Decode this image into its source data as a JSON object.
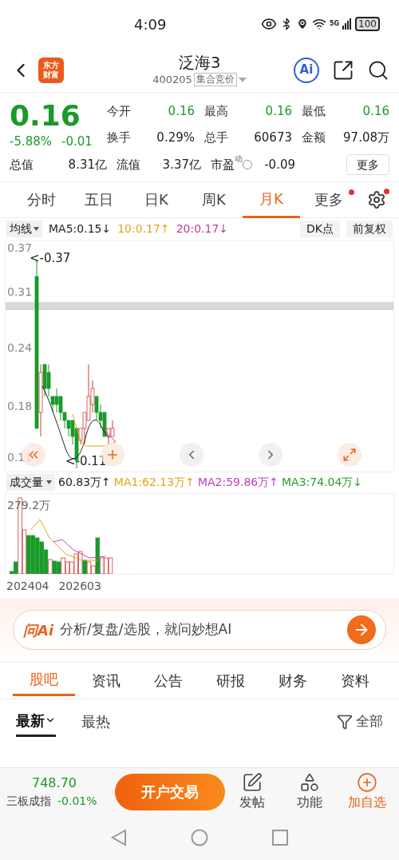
{
  "status_bar": {
    "time": "4:09",
    "network": "5G",
    "battery": "100"
  },
  "header": {
    "logo": [
      "东方",
      "财富"
    ],
    "title": "泛海3",
    "code": "400205",
    "badge": "集合竞价",
    "ai": "Ai"
  },
  "quote": {
    "price": "0.16",
    "change_pct": "-5.88%",
    "change": "-0.01",
    "fields": [
      {
        "label": "今开",
        "value": "0.16",
        "kind": "down"
      },
      {
        "label": "最高",
        "value": "0.16",
        "kind": "down"
      },
      {
        "label": "最低",
        "value": "0.16",
        "kind": "down"
      },
      {
        "label": "换手",
        "value": "0.29%",
        "kind": "flat"
      },
      {
        "label": "总手",
        "value": "60673",
        "kind": "flat"
      },
      {
        "label": "金额",
        "value": "97.08万",
        "kind": "flat"
      },
      {
        "label": "总值",
        "value": "8.31亿",
        "kind": "flat"
      },
      {
        "label": "流值",
        "value": "3.37亿",
        "kind": "flat"
      },
      {
        "label": "市盈",
        "sup": "动",
        "value": "-0.09",
        "kind": "flat"
      }
    ],
    "more": "更多"
  },
  "chart_tabs": [
    {
      "label": "分时",
      "selected": false
    },
    {
      "label": "五日",
      "selected": false
    },
    {
      "label": "日K",
      "selected": false
    },
    {
      "label": "周K",
      "selected": false
    },
    {
      "label": "月K",
      "selected": true
    },
    {
      "label": "更多",
      "selected": false,
      "dot": true
    }
  ],
  "ma_bar": {
    "selector": "均线",
    "items": [
      {
        "text": "MA5:0.15↓",
        "color": "#222222"
      },
      {
        "text": "10:0.17↑",
        "color": "#e8a31c"
      },
      {
        "text": "20:0.17↓",
        "color": "#c0399a"
      }
    ],
    "dk": "DK点",
    "adjust": "前复权"
  },
  "price_chart": {
    "axis": [
      "0.37",
      "0.31",
      "0.24",
      "0.18",
      "0.11"
    ],
    "max_label": "<-0.37",
    "min_label": "<-0.11"
  },
  "volume": {
    "selector": "成交量",
    "items": [
      {
        "text": "60.83万↑",
        "color": "#222222"
      },
      {
        "text": "MA1:62.13万↑",
        "color": "#e8a31c"
      },
      {
        "text": "MA2:59.86万↑",
        "color": "#c040c0"
      },
      {
        "text": "MA3:74.04万↓",
        "color": "#2e9a2e"
      }
    ],
    "max": "279.2万",
    "dates": [
      "202404",
      "202603"
    ]
  },
  "ai_bar": {
    "logo": "问Ai",
    "placeholder": "分析/复盘/选股，就问妙想AI"
  },
  "section_tabs": [
    {
      "label": "股吧",
      "selected": true
    },
    {
      "label": "资讯",
      "selected": false
    },
    {
      "label": "公告",
      "selected": false
    },
    {
      "label": "研报",
      "selected": false
    },
    {
      "label": "财务",
      "selected": false
    },
    {
      "label": "资料",
      "selected": false
    }
  ],
  "sort_tabs": [
    {
      "label": "最新",
      "selected": true
    },
    {
      "label": "最热",
      "selected": false
    }
  ],
  "filter": "全部",
  "bottom_bar": {
    "index_value": "748.70",
    "index_name": "三板成指",
    "index_change": "-0.01%",
    "trade": "开户交易",
    "actions": [
      {
        "label": "发帖",
        "kind": "post",
        "selected": false
      },
      {
        "label": "功能",
        "kind": "grid",
        "selected": false
      },
      {
        "label": "加自选",
        "kind": "add",
        "selected": true
      }
    ]
  }
}
